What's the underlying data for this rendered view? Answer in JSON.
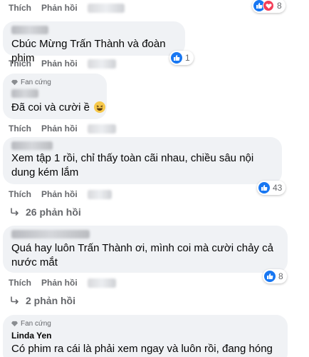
{
  "actions": {
    "like": "Thích",
    "reply": "Phản hồi"
  },
  "comments": [
    {
      "reaction_count": "8"
    },
    {
      "text": "Cbúc Mừng Trấn Thành và đoàn phim",
      "reaction_count": "1"
    },
    {
      "badge": "Fan cứng",
      "text": "Đã coi và cười ề"
    },
    {
      "author_partial": "Doanh To",
      "text": "Xem tập 1 rồi, chỉ thấy toàn cãi nhau, chiều sâu nội dung kém lắm",
      "reaction_count": "43",
      "replies": "26 phản hồi"
    },
    {
      "text": "Quá hay luôn Trấn Thành ơi, mình coi mà cười chảy cả nước mắt",
      "reaction_count": "8",
      "replies": "2 phản hồi"
    },
    {
      "badge": "Fan cứng",
      "author": "Linda Yen",
      "text": "Có phim ra cái là phải xem ngay và luôn rồi, đang hóng"
    }
  ],
  "colors": {
    "bubble": "#f0f2f5",
    "secondary_text": "#65676b",
    "like_blue": "#1877f2",
    "heart_red": "#f33e58"
  },
  "icons": [
    "like-icon",
    "heart-icon",
    "reply-arrow-icon",
    "fan-badge-diamond-icon",
    "laughing-emoji-icon"
  ]
}
